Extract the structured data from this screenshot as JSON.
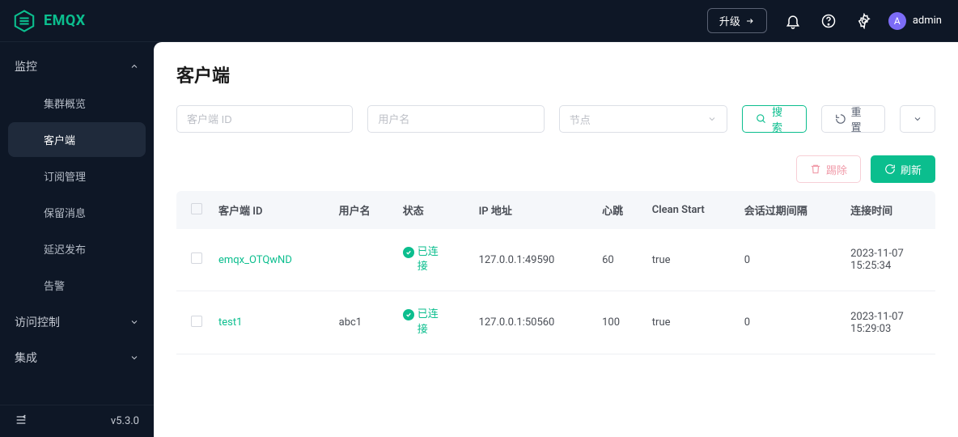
{
  "header": {
    "brand": "EMQX",
    "upgrade_label": "升级",
    "avatar_initial": "A",
    "username": "admin"
  },
  "sidebar": {
    "groups": [
      {
        "label": "监控",
        "expanded": true,
        "items": [
          {
            "label": "集群概览"
          },
          {
            "label": "客户端",
            "active": true
          },
          {
            "label": "订阅管理"
          },
          {
            "label": "保留消息"
          },
          {
            "label": "延迟发布"
          },
          {
            "label": "告警"
          }
        ]
      },
      {
        "label": "访问控制",
        "expanded": false
      },
      {
        "label": "集成",
        "expanded": false
      }
    ],
    "version": "v5.3.0"
  },
  "page": {
    "title": "客户端",
    "filters": {
      "clientid_placeholder": "客户端 ID",
      "username_placeholder": "用户名",
      "node_placeholder": "节点",
      "search_label": "搜索",
      "reset_label": "重置"
    },
    "actions": {
      "kick_label": "踢除",
      "refresh_label": "刷新"
    },
    "columns": {
      "clientid": "客户端 ID",
      "username": "用户名",
      "status": "状态",
      "ip": "IP 地址",
      "keepalive": "心跳",
      "clean_start": "Clean Start",
      "expiry": "会话过期间隔",
      "connected_at": "连接时间"
    },
    "status_connected": "已连接",
    "rows": [
      {
        "clientid": "emqx_OTQwND",
        "username": "",
        "ip": "127.0.0.1:49590",
        "keepalive": "60",
        "clean_start": "true",
        "expiry": "0",
        "connected_l1": "2023-11-07",
        "connected_l2": "15:25:34"
      },
      {
        "clientid": "test1",
        "username": "abc1",
        "ip": "127.0.0.1:50560",
        "keepalive": "100",
        "clean_start": "true",
        "expiry": "0",
        "connected_l1": "2023-11-07",
        "connected_l2": "15:29:03"
      }
    ]
  }
}
